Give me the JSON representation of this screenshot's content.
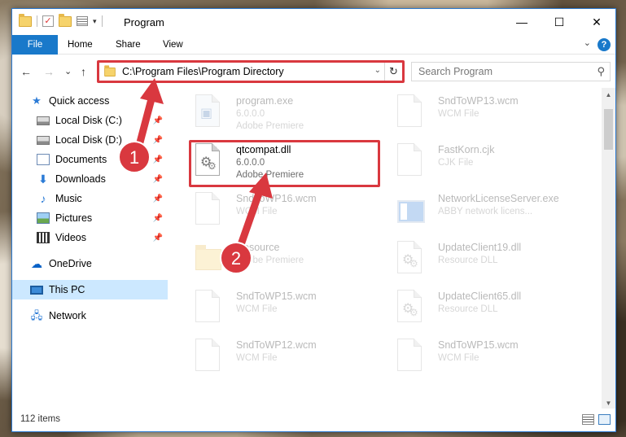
{
  "window": {
    "title": "Program",
    "controls": {
      "minimize": "—",
      "maximize": "☐",
      "close": "✕"
    }
  },
  "ribbon": {
    "tabs": [
      "File",
      "Home",
      "Share",
      "View"
    ],
    "help": "?",
    "collapse": "⌄"
  },
  "nav": {
    "back": "←",
    "forward": "→",
    "recent": "⌄",
    "up": "↑"
  },
  "address": {
    "path": "C:\\Program Files\\Program Directory",
    "dropdown": "⌄",
    "refresh": "↻"
  },
  "search": {
    "placeholder": "Search Program"
  },
  "sidebar": {
    "items": [
      {
        "label": "Quick access",
        "icon": "star-icon",
        "pinned": false
      },
      {
        "label": "Local Disk (C:)",
        "icon": "disk-icon",
        "pinned": true
      },
      {
        "label": "Local Disk (D:)",
        "icon": "disk-icon",
        "pinned": true
      },
      {
        "label": "Documents",
        "icon": "documents-icon",
        "pinned": true
      },
      {
        "label": "Downloads",
        "icon": "download-icon",
        "pinned": true
      },
      {
        "label": "Music",
        "icon": "music-icon",
        "pinned": true
      },
      {
        "label": "Pictures",
        "icon": "pictures-icon",
        "pinned": true
      },
      {
        "label": "Videos",
        "icon": "videos-icon",
        "pinned": true
      },
      {
        "label": "OneDrive",
        "icon": "cloud-icon",
        "pinned": false
      },
      {
        "label": "This PC",
        "icon": "pc-icon",
        "pinned": false,
        "selected": true
      },
      {
        "label": "Network",
        "icon": "network-icon",
        "pinned": false
      }
    ],
    "pin_glyph": "📌"
  },
  "files": [
    {
      "name": "program.exe",
      "line1": "6.0.0.0",
      "line2": "Adobe Premiere",
      "icon": "exe-icon",
      "faded": true
    },
    {
      "name": "SndToWP13.wcm",
      "line1": "WCM File",
      "line2": "",
      "icon": "file-icon",
      "faded": true
    },
    {
      "name": "qtcompat.dll",
      "line1": "6.0.0.0",
      "line2": "Adobe Premiere",
      "icon": "dll-icon",
      "faded": false
    },
    {
      "name": "FastKorn.cjk",
      "line1": "CJK File",
      "line2": "",
      "icon": "file-icon",
      "faded": true
    },
    {
      "name": "SndToWP16.wcm",
      "line1": "WCM File",
      "line2": "",
      "icon": "file-icon",
      "faded": true
    },
    {
      "name": "NetworkLicenseServer.exe",
      "line1": "ABBY network licens...",
      "line2": "",
      "icon": "app-icon",
      "faded": true
    },
    {
      "name": "Resource",
      "line1": "Adobe Premiere",
      "line2": "",
      "icon": "folder-icon",
      "faded": true
    },
    {
      "name": "UpdateClient19.dll",
      "line1": "Resource DLL",
      "line2": "",
      "icon": "dll-icon",
      "faded": true
    },
    {
      "name": "SndToWP15.wcm",
      "line1": "WCM File",
      "line2": "",
      "icon": "file-icon",
      "faded": true
    },
    {
      "name": "UpdateClient65.dll",
      "line1": "Resource DLL",
      "line2": "",
      "icon": "dll-icon",
      "faded": true
    },
    {
      "name": "SndToWP12.wcm",
      "line1": "WCM File",
      "line2": "",
      "icon": "file-icon",
      "faded": true
    },
    {
      "name": "SndToWP15.wcm",
      "line1": "WCM File",
      "line2": "",
      "icon": "file-icon",
      "faded": true
    }
  ],
  "status": {
    "count": "112 items"
  },
  "annotations": {
    "step1": "1",
    "step2": "2",
    "color": "#d9383f"
  }
}
